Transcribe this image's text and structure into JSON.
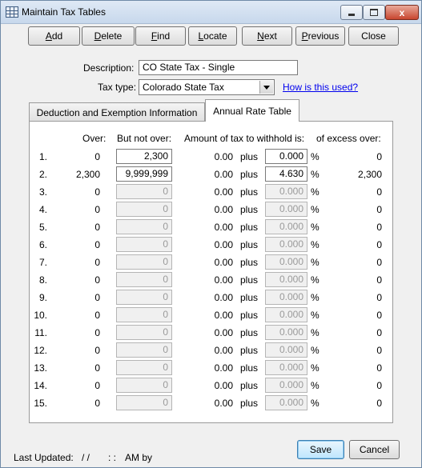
{
  "window": {
    "title": "Maintain Tax Tables",
    "close_glyph": "x"
  },
  "toolbar": [
    {
      "name": "add-button",
      "ul": "A",
      "rest": "dd"
    },
    {
      "name": "delete-button",
      "ul": "D",
      "rest": "elete"
    },
    {
      "name": "find-button",
      "ul": "F",
      "rest": "ind"
    },
    {
      "name": "locate-button",
      "ul": "L",
      "rest": "ocate"
    },
    {
      "name": "next-button",
      "ul": "N",
      "rest": "ext"
    },
    {
      "name": "previous-button",
      "ul": "P",
      "rest": "revious"
    },
    {
      "name": "close-button",
      "ul": "",
      "rest": "Close"
    }
  ],
  "form": {
    "description_label": "Description:",
    "description_value": "CO State Tax - Single",
    "tax_type_label": "Tax type:",
    "tax_type_value": "Colorado State Tax",
    "help_link": "How is this used?"
  },
  "tabs": {
    "deduction": "Deduction and Exemption Information",
    "annual": "Annual Rate Table"
  },
  "table": {
    "headers": {
      "over": "Over:",
      "but_not_over": "But not over:",
      "amount": "Amount of tax to withhold is:",
      "excess": "of excess over:"
    },
    "plus_text": "plus",
    "pct_text": "%",
    "rows": [
      {
        "n": "1.",
        "over": "0",
        "bno": "2,300",
        "amt": "0.00",
        "rate": "0.000",
        "excess": "0",
        "enabled": true
      },
      {
        "n": "2.",
        "over": "2,300",
        "bno": "9,999,999",
        "amt": "0.00",
        "rate": "4.630",
        "excess": "2,300",
        "enabled": true
      },
      {
        "n": "3.",
        "over": "0",
        "bno": "0",
        "amt": "0.00",
        "rate": "0.000",
        "excess": "0",
        "enabled": false
      },
      {
        "n": "4.",
        "over": "0",
        "bno": "0",
        "amt": "0.00",
        "rate": "0.000",
        "excess": "0",
        "enabled": false
      },
      {
        "n": "5.",
        "over": "0",
        "bno": "0",
        "amt": "0.00",
        "rate": "0.000",
        "excess": "0",
        "enabled": false
      },
      {
        "n": "6.",
        "over": "0",
        "bno": "0",
        "amt": "0.00",
        "rate": "0.000",
        "excess": "0",
        "enabled": false
      },
      {
        "n": "7.",
        "over": "0",
        "bno": "0",
        "amt": "0.00",
        "rate": "0.000",
        "excess": "0",
        "enabled": false
      },
      {
        "n": "8.",
        "over": "0",
        "bno": "0",
        "amt": "0.00",
        "rate": "0.000",
        "excess": "0",
        "enabled": false
      },
      {
        "n": "9.",
        "over": "0",
        "bno": "0",
        "amt": "0.00",
        "rate": "0.000",
        "excess": "0",
        "enabled": false
      },
      {
        "n": "10.",
        "over": "0",
        "bno": "0",
        "amt": "0.00",
        "rate": "0.000",
        "excess": "0",
        "enabled": false
      },
      {
        "n": "11.",
        "over": "0",
        "bno": "0",
        "amt": "0.00",
        "rate": "0.000",
        "excess": "0",
        "enabled": false
      },
      {
        "n": "12.",
        "over": "0",
        "bno": "0",
        "amt": "0.00",
        "rate": "0.000",
        "excess": "0",
        "enabled": false
      },
      {
        "n": "13.",
        "over": "0",
        "bno": "0",
        "amt": "0.00",
        "rate": "0.000",
        "excess": "0",
        "enabled": false
      },
      {
        "n": "14.",
        "over": "0",
        "bno": "0",
        "amt": "0.00",
        "rate": "0.000",
        "excess": "0",
        "enabled": false
      },
      {
        "n": "15.",
        "over": "0",
        "bno": "0",
        "amt": "0.00",
        "rate": "0.000",
        "excess": "0",
        "enabled": false
      }
    ]
  },
  "footer": {
    "last_updated": "Last Updated:",
    "date_value": "/ /",
    "time_value": ": :",
    "ampm_by": "AM by",
    "save": "Save",
    "cancel": "Cancel"
  },
  "colors": {
    "link": "#0000ee",
    "disabled_text": "#9a9a9a"
  }
}
